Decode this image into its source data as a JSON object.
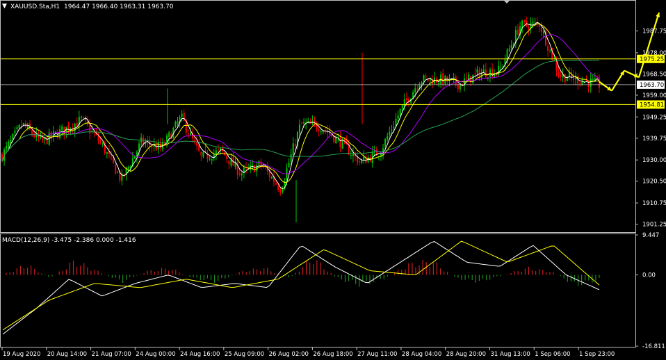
{
  "header": {
    "symbol": "XAUUSD.Sta,H1",
    "ohlc": "1964.47 1966.40 1963.31 1963.70"
  },
  "macd_header": "MACD(12,26,9) -3.475 -2.386 0.000 -1.416",
  "price_axis": {
    "ticks": [
      "1987.75",
      "1978.00",
      "1968.50",
      "1959.00",
      "1949.25",
      "1939.75",
      "1930.00",
      "1920.50",
      "1910.75",
      "1901.25"
    ],
    "current_price": "1963.70",
    "upper_level": "1975.25",
    "lower_level": "1954.81"
  },
  "macd_axis": {
    "ticks": [
      "9.447",
      "0.00",
      "-16.811"
    ]
  },
  "time_axis": {
    "labels": [
      "19 Aug 2020",
      "20 Aug 14:00",
      "21 Aug 07:00",
      "24 Aug 00:00",
      "24 Aug 16:00",
      "25 Aug 09:00",
      "26 Aug 02:00",
      "26 Aug 18:00",
      "27 Aug 11:00",
      "28 Aug 04:00",
      "28 Aug 20:00",
      "31 Aug 13:00",
      "1 Sep 06:00",
      "1 Sep 23:00"
    ]
  },
  "colors": {
    "background": "#000000",
    "bull_candle": "#00c800",
    "bear_candle": "#ff0000",
    "ma_fast": "#ffffff",
    "ma_mid": "#ffff00",
    "ma_slow": "#b000ff",
    "ma_long": "#28a050",
    "level_line": "#ffff00",
    "price_line": "#c0c0c0",
    "arrow": "#ffff00",
    "hist_pos": "#c81e1e",
    "hist_neg": "#1e8c1e"
  },
  "chart_data": {
    "type": "candlestick",
    "symbol": "XAUUSD.Sta",
    "timeframe": "H1",
    "ylim": [
      1898,
      2001
    ],
    "price_path": [
      {
        "t": "19 Aug 2020",
        "v": 1932
      },
      {
        "t": "19 Aug 2020 +6h",
        "v": 1946
      },
      {
        "t": "20 Aug 02:00",
        "v": 1938
      },
      {
        "t": "20 Aug 14:00",
        "v": 1943
      },
      {
        "t": "20 Aug 20:00",
        "v": 1948
      },
      {
        "t": "21 Aug 07:00",
        "v": 1937
      },
      {
        "t": "21 Aug 12:00",
        "v": 1921
      },
      {
        "t": "21 Aug 18:00",
        "v": 1938
      },
      {
        "t": "24 Aug 00:00",
        "v": 1935
      },
      {
        "t": "24 Aug 08:00",
        "v": 1949
      },
      {
        "t": "24 Aug 16:00",
        "v": 1931
      },
      {
        "t": "25 Aug 01:00",
        "v": 1934
      },
      {
        "t": "25 Aug 09:00",
        "v": 1924
      },
      {
        "t": "25 Aug 18:00",
        "v": 1928
      },
      {
        "t": "26 Aug 02:00",
        "v": 1917
      },
      {
        "t": "26 Aug 10:00",
        "v": 1946
      },
      {
        "t": "26 Aug 18:00",
        "v": 1945
      },
      {
        "t": "27 Aug 02:00",
        "v": 1938
      },
      {
        "t": "27 Aug 11:00",
        "v": 1929
      },
      {
        "t": "27 Aug 20:00",
        "v": 1934
      },
      {
        "t": "28 Aug 04:00",
        "v": 1952
      },
      {
        "t": "28 Aug 12:00",
        "v": 1966
      },
      {
        "t": "28 Aug 20:00",
        "v": 1966
      },
      {
        "t": "31 Aug 04:00",
        "v": 1964
      },
      {
        "t": "31 Aug 13:00",
        "v": 1969
      },
      {
        "t": "31 Aug 22:00",
        "v": 1970
      },
      {
        "t": "1 Sep 03:00",
        "v": 1990
      },
      {
        "t": "1 Sep 06:00",
        "v": 1991
      },
      {
        "t": "1 Sep 14:00",
        "v": 1968
      },
      {
        "t": "1 Sep 23:00",
        "v": 1966
      },
      {
        "t": "2 Sep 03:00",
        "v": 1963.7
      }
    ],
    "horizontal_levels": [
      1975.25,
      1954.81
    ],
    "current_price": 1963.7,
    "projection_arrows": [
      {
        "from": 1965,
        "to": 1961
      },
      {
        "from": 1961,
        "to": 1970
      },
      {
        "from": 1970,
        "to": 1967
      },
      {
        "from": 1967,
        "to": 1996
      }
    ],
    "indicator": {
      "name": "MACD(12,26,9)",
      "values": [
        -3.475,
        -2.386,
        0.0,
        -1.416
      ],
      "ylim": [
        -16.811,
        9.447
      ],
      "histogram": [
        {
          "t": "19 Aug 2020",
          "v": 0
        },
        {
          "t": "19 Aug 12:00",
          "v": 3
        },
        {
          "t": "20 Aug 02:00",
          "v": -1
        },
        {
          "t": "20 Aug 14:00",
          "v": 4
        },
        {
          "t": "20 Aug 22:00",
          "v": 1
        },
        {
          "t": "21 Aug 07:00",
          "v": -2
        },
        {
          "t": "21 Aug 18:00",
          "v": 1
        },
        {
          "t": "24 Aug 04:00",
          "v": 2
        },
        {
          "t": "24 Aug 12:00",
          "v": -1
        },
        {
          "t": "24 Aug 20:00",
          "v": -2
        },
        {
          "t": "25 Aug 09:00",
          "v": 1
        },
        {
          "t": "25 Aug 18:00",
          "v": 2
        },
        {
          "t": "26 Aug 02:00",
          "v": -1
        },
        {
          "t": "26 Aug 12:00",
          "v": 5
        },
        {
          "t": "26 Aug 20:00",
          "v": -1
        },
        {
          "t": "27 Aug 06:00",
          "v": -3
        },
        {
          "t": "27 Aug 16:00",
          "v": -1
        },
        {
          "t": "28 Aug 04:00",
          "v": 3
        },
        {
          "t": "28 Aug 14:00",
          "v": 4
        },
        {
          "t": "28 Aug 22:00",
          "v": -1
        },
        {
          "t": "31 Aug 08:00",
          "v": -2
        },
        {
          "t": "31 Aug 16:00",
          "v": 0
        },
        {
          "t": "1 Sep 02:00",
          "v": 2
        },
        {
          "t": "1 Sep 10:00",
          "v": 1
        },
        {
          "t": "1 Sep 18:00",
          "v": -3
        },
        {
          "t": "2 Sep 03:00",
          "v": -1.4
        }
      ],
      "macd_line": [
        {
          "t": "19 Aug 2020",
          "v": -14
        },
        {
          "t": "20 Aug 06:00",
          "v": -8
        },
        {
          "t": "20 Aug 20:00",
          "v": -1
        },
        {
          "t": "21 Aug 12:00",
          "v": -5
        },
        {
          "t": "24 Aug 00:00",
          "v": -2
        },
        {
          "t": "24 Aug 10:00",
          "v": 0
        },
        {
          "t": "24 Aug 20:00",
          "v": -3
        },
        {
          "t": "25 Aug 12:00",
          "v": -2
        },
        {
          "t": "26 Aug 02:00",
          "v": -3
        },
        {
          "t": "26 Aug 14:00",
          "v": 7
        },
        {
          "t": "27 Aug 02:00",
          "v": 2
        },
        {
          "t": "27 Aug 16:00",
          "v": -2
        },
        {
          "t": "28 Aug 08:00",
          "v": 3
        },
        {
          "t": "28 Aug 18:00",
          "v": 8
        },
        {
          "t": "31 Aug 04:00",
          "v": 3
        },
        {
          "t": "31 Aug 16:00",
          "v": 2
        },
        {
          "t": "1 Sep 06:00",
          "v": 7
        },
        {
          "t": "1 Sep 18:00",
          "v": 0
        },
        {
          "t": "2 Sep 03:00",
          "v": -3.5
        }
      ],
      "signal_line": [
        {
          "t": "19 Aug 2020",
          "v": -13
        },
        {
          "t": "20 Aug 12:00",
          "v": -6
        },
        {
          "t": "21 Aug 06:00",
          "v": -2
        },
        {
          "t": "21 Aug 20:00",
          "v": -3
        },
        {
          "t": "24 Aug 14:00",
          "v": -1
        },
        {
          "t": "25 Aug 08:00",
          "v": -3
        },
        {
          "t": "26 Aug 04:00",
          "v": -1
        },
        {
          "t": "26 Aug 20:00",
          "v": 6
        },
        {
          "t": "27 Aug 12:00",
          "v": 1
        },
        {
          "t": "28 Aug 06:00",
          "v": 0
        },
        {
          "t": "28 Aug 22:00",
          "v": 8
        },
        {
          "t": "31 Aug 12:00",
          "v": 3
        },
        {
          "t": "1 Sep 08:00",
          "v": 7
        },
        {
          "t": "2 Sep 03:00",
          "v": -2.4
        }
      ]
    }
  }
}
